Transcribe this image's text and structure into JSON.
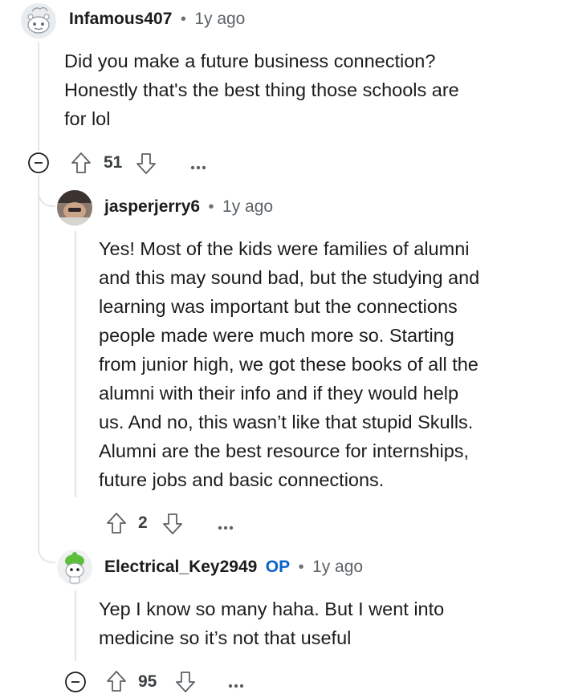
{
  "comments": [
    {
      "username": "Infamous407",
      "separator": "•",
      "time": "1y ago",
      "body": [
        "Did you make a future business connection?",
        "Honestly that's the best thing those schools are",
        "for lol"
      ],
      "votes": "51",
      "avatar_icon": "snoo-avatar-icon"
    },
    {
      "username": "jasperjerry6",
      "separator": "•",
      "time": "1y ago",
      "body": [
        "Yes! Most of the kids were families of alumni",
        "and this may sound bad, but the studying and",
        "learning was important but the connections",
        "people made were much more so. Starting",
        "from junior high, we got these books of all the",
        "alumni with their info and if they would help",
        "us. And no, this wasn’t like that stupid Skulls.",
        "Alumni are the best resource for internships,",
        "future jobs and basic connections."
      ],
      "votes": "2",
      "avatar_icon": "photo-avatar-icon"
    },
    {
      "username": "Electrical_Key2949",
      "op_badge": "OP",
      "separator": "•",
      "time": "1y ago",
      "body": [
        "Yep I know so many haha. But I went into",
        "medicine so it’s not that useful"
      ],
      "votes": "95",
      "avatar_icon": "green-snoo-avatar-icon"
    }
  ],
  "icons": {
    "upvote": "upvote-arrow-icon",
    "downvote": "downvote-arrow-icon",
    "more": "more-options-icon",
    "collapse": "collapse-thread-icon"
  },
  "colors": {
    "op": "#0b63c9",
    "thread": "#e3e5e7",
    "text": "#1c1c1c",
    "meta": "#5c6266"
  }
}
